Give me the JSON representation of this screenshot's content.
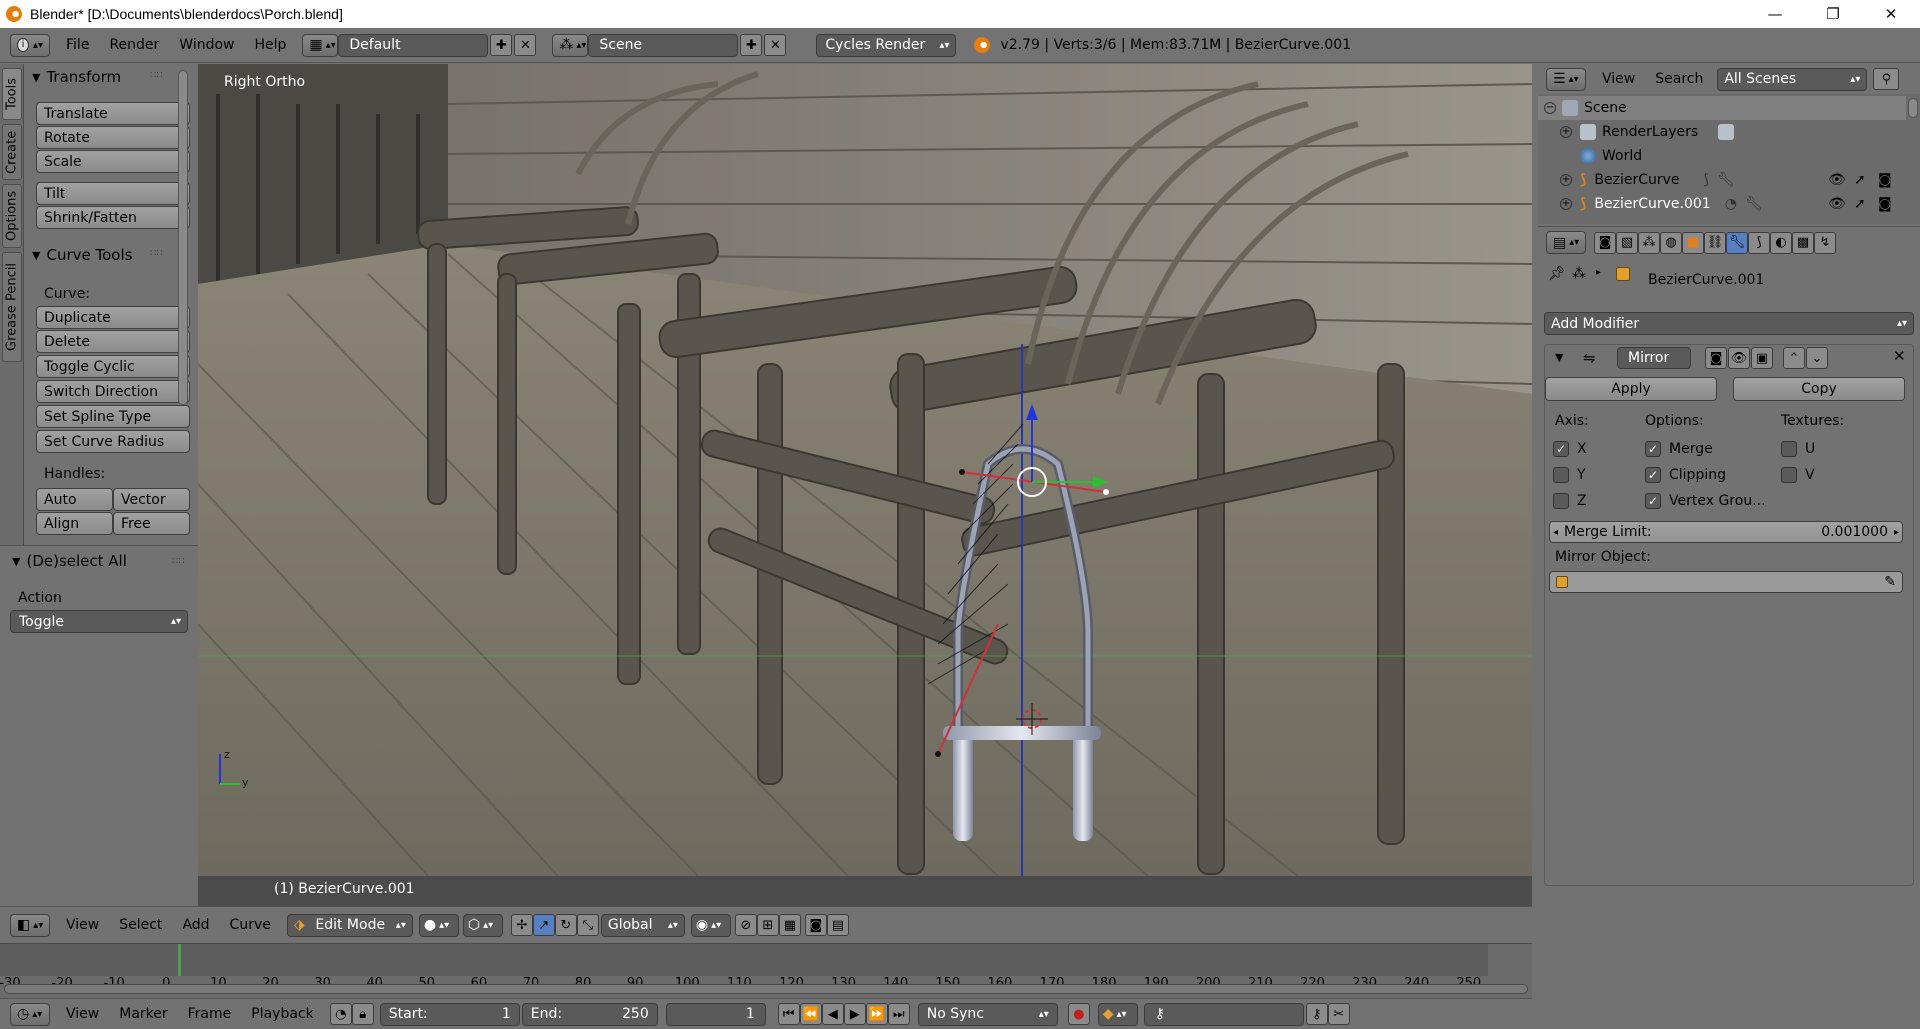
{
  "window": {
    "title": "Blender* [D:\\Documents\\blenderdocs\\Porch.blend]",
    "minimize": "—",
    "maximize": "❐",
    "close": "✕"
  },
  "header": {
    "menus": [
      "File",
      "Render",
      "Window",
      "Help"
    ],
    "layout": "Default",
    "scene": "Scene",
    "engine": "Cycles Render",
    "info": "v2.79 | Verts:3/6 | Mem:83.71M | BezierCurve.001"
  },
  "toolshelf": {
    "tabs": [
      "Tools",
      "Create",
      "Options",
      "Grease Pencil"
    ],
    "transform": {
      "title": "Transform",
      "buttons": [
        "Translate",
        "Rotate",
        "Scale",
        "Tilt",
        "Shrink/Fatten"
      ]
    },
    "curve_tools": {
      "title": "Curve Tools",
      "curve_label": "Curve:",
      "buttons": [
        "Duplicate",
        "Delete",
        "Toggle Cyclic",
        "Switch Direction",
        "Set Spline Type",
        "Set Curve Radius"
      ],
      "handles_label": "Handles:",
      "handle_buttons": [
        "Auto",
        "Vector",
        "Align",
        "Free"
      ]
    }
  },
  "redo": {
    "title": "(De)select All",
    "action_label": "Action",
    "action_value": "Toggle"
  },
  "viewport": {
    "view_name": "Right Ortho",
    "object_label": "(1) BezierCurve.001",
    "axis_z": "z",
    "axis_y": "y"
  },
  "viewport_header": {
    "menus": [
      "View",
      "Select",
      "Add",
      "Curve"
    ],
    "mode": "Edit Mode",
    "orientation": "Global"
  },
  "timeline": {
    "ticks": [
      "-30",
      "-20",
      "-10",
      "0",
      "10",
      "20",
      "30",
      "40",
      "50",
      "60",
      "70",
      "80",
      "90",
      "100",
      "110",
      "120",
      "130",
      "140",
      "150",
      "160",
      "170",
      "180",
      "190",
      "200",
      "210",
      "220",
      "230",
      "240",
      "250"
    ],
    "current_frame": 1
  },
  "timeline_bar": {
    "menus": [
      "View",
      "Marker",
      "Frame",
      "Playback"
    ],
    "start_label": "Start:",
    "start_value": "1",
    "end_label": "End:",
    "end_value": "250",
    "frame_value": "1",
    "sync": "No Sync"
  },
  "outliner": {
    "menus": [
      "View",
      "Search"
    ],
    "filter": "All Scenes",
    "items": [
      {
        "name": "Scene",
        "depth": 0
      },
      {
        "name": "RenderLayers",
        "depth": 1
      },
      {
        "name": "World",
        "depth": 1
      },
      {
        "name": "BezierCurve",
        "depth": 1
      },
      {
        "name": "BezierCurve.001",
        "depth": 1
      }
    ]
  },
  "properties": {
    "object_name": "BezierCurve.001",
    "add_modifier": "Add Modifier",
    "modifier_name": "Mirror",
    "apply": "Apply",
    "copy": "Copy",
    "axis_label": "Axis:",
    "options_label": "Options:",
    "textures_label": "Textures:",
    "axes": [
      {
        "label": "X",
        "checked": true
      },
      {
        "label": "Y",
        "checked": false
      },
      {
        "label": "Z",
        "checked": false
      }
    ],
    "options": [
      {
        "label": "Merge",
        "checked": true
      },
      {
        "label": "Clipping",
        "checked": true
      },
      {
        "label": "Vertex Grou...",
        "checked": true
      }
    ],
    "textures": [
      {
        "label": "U",
        "checked": false
      },
      {
        "label": "V",
        "checked": false
      }
    ],
    "merge_limit_label": "Merge Limit:",
    "merge_limit_value": "0.001000",
    "mirror_object_label": "Mirror Object:"
  },
  "colors": {
    "accent": "#5680c2",
    "header": "#737373",
    "panel": "#727272",
    "timeline_cursor": "#4ea24e"
  }
}
